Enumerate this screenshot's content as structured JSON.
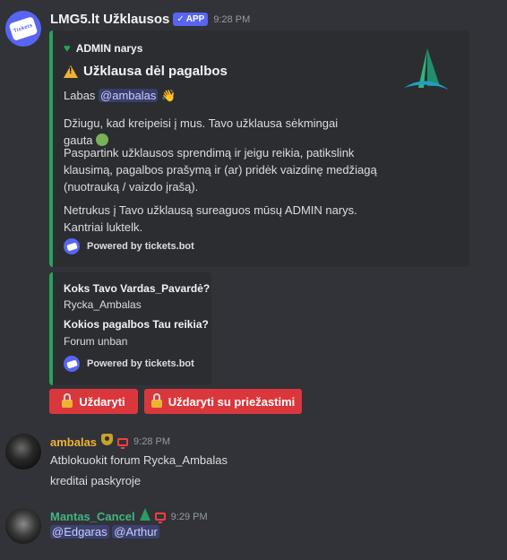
{
  "bot_message": {
    "username": "LMG5.lt Užklausos",
    "badge": "APP",
    "timestamp": "9:28 PM",
    "avatar_icon": "ticket-icon",
    "embed": {
      "accent_color": "#23a55a",
      "author": "ADMIN narys",
      "title": "Užklausa dėl pagalbos",
      "greeting_prefix": "Labas",
      "greeting_mention": "@ambalas",
      "paragraph1": "Džiugu, kad kreipeisi į mus. Tavo užklausa sėkmingai gauta",
      "paragraph2": "Paspartink užklausos sprendimą ir jeigu reikia, patikslink klausimą, pagalbos prašymą ir (ar) pridėk vaizdinę medžiagą (nuotrauką / vaizdo įrašą).",
      "paragraph3": "Netrukus į Tavo užklausą sureaguos mūsų ADMIN narys. Kantriai luktelk.",
      "footer": "Powered by tickets.bot"
    },
    "form_embed": {
      "field1_name": "Koks Tavo Vardas_Pavardė?",
      "field1_value": "Rycka_Ambalas",
      "field2_name": "Kokios pagalbos Tau reikia?",
      "field2_value": "Forum unban",
      "footer": "Powered by tickets.bot"
    },
    "buttons": {
      "close": "Uždaryti",
      "close_reason": "Uždaryti su priežastimi",
      "color": "#da373c"
    }
  },
  "user_message_1": {
    "username": "ambalas",
    "timestamp": "9:28 PM",
    "name_color": "#f0b232",
    "line1": "Atblokuokit forum Rycka_Ambalas",
    "line2": "kreditai paskyroje"
  },
  "user_message_2": {
    "username": "Mantas_Cancel",
    "timestamp": "9:29 PM",
    "name_color": "#43b581",
    "mention1": "@Edgaras",
    "mention2": "@Arthur"
  }
}
